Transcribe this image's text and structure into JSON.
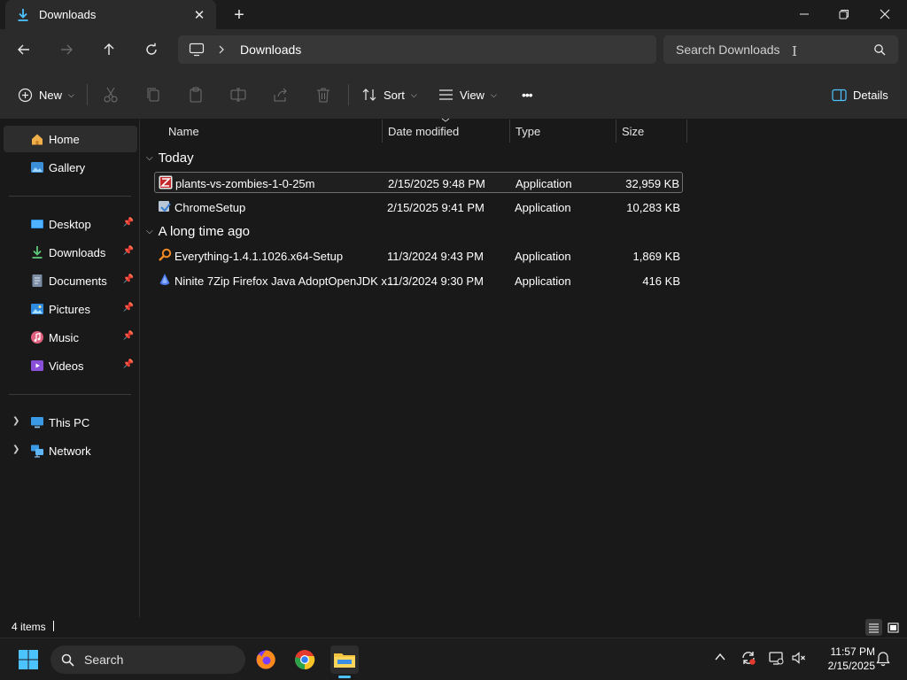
{
  "window": {
    "tab_title": "Downloads",
    "minimize_label": "—",
    "colors": {
      "background": "#191919",
      "toolbar": "#2b2b2b",
      "accent": "#4cc2ff"
    }
  },
  "address": {
    "crumb": "Downloads",
    "search_placeholder": "Search Downloads"
  },
  "commandbar": {
    "new_label": "New",
    "sort_label": "Sort",
    "view_label": "View",
    "more_label": "•••",
    "details_label": "Details"
  },
  "sidebar": {
    "home": "Home",
    "gallery": "Gallery",
    "desktop": "Desktop",
    "downloads": "Downloads",
    "documents": "Documents",
    "pictures": "Pictures",
    "music": "Music",
    "videos": "Videos",
    "this_pc": "This PC",
    "network": "Network"
  },
  "columns": {
    "name": "Name",
    "date": "Date modified",
    "type": "Type",
    "size": "Size"
  },
  "groups": {
    "today": "Today",
    "long_ago": "A long time ago"
  },
  "files": [
    {
      "name": "plants-vs-zombies-1-0-25m",
      "date": "2/15/2025 9:48 PM",
      "type": "Application",
      "size": "32,959 KB",
      "icon": "pvz-installer-icon"
    },
    {
      "name": "ChromeSetup",
      "date": "2/15/2025 9:41 PM",
      "type": "Application",
      "size": "10,283 KB",
      "icon": "installer-icon"
    },
    {
      "name": "Everything-1.4.1.1026.x64-Setup",
      "date": "11/3/2024 9:43 PM",
      "type": "Application",
      "size": "1,869 KB",
      "icon": "magnifier-icon"
    },
    {
      "name": "Ninite 7Zip Firefox Java AdoptOpenJDK x...",
      "date": "11/3/2024 9:30 PM",
      "type": "Application",
      "size": "416 KB",
      "icon": "ninite-icon"
    }
  ],
  "status": {
    "items": "4 items"
  },
  "taskbar": {
    "search_label": "Search",
    "time": "11:57 PM",
    "date": "2/15/2025"
  }
}
